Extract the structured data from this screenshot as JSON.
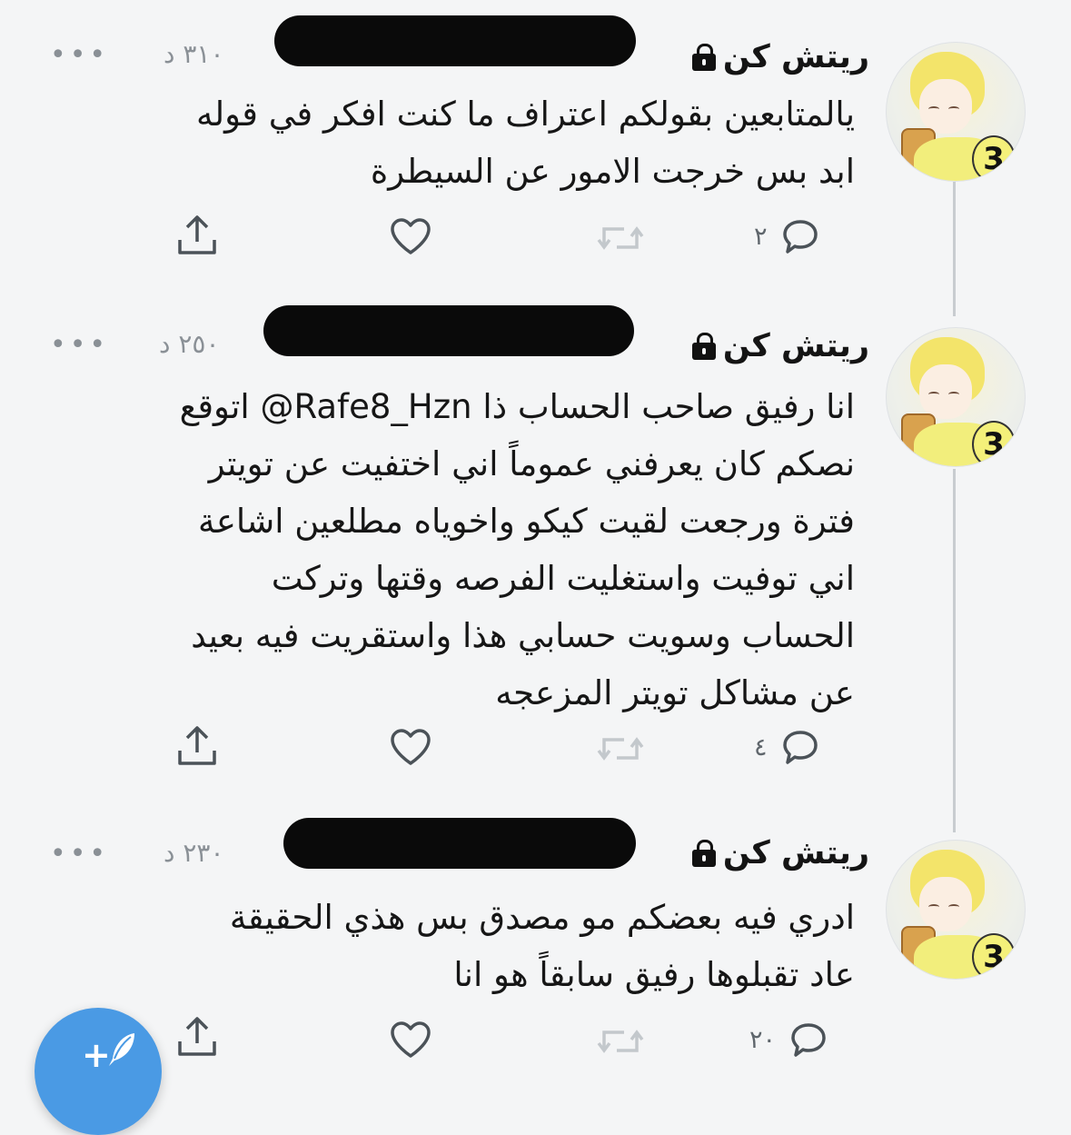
{
  "tweets": [
    {
      "display_name": "ريتش كن",
      "time": "٣١٠ د",
      "text": "يالمتابعين بقولكم اعتراف ما كنت افكر في قوله\nابد بس خرجت الامور عن السيطرة",
      "reply_count": "٢"
    },
    {
      "display_name": "ريتش كن",
      "time": "٢٥٠ د",
      "text": "انا رفيق صاحب الحساب ذا ‎@Rafe8_Hzn‏ اتوقع\nنصكم كان يعرفني عموماً اني اختفيت عن تويتر\nفترة ورجعت لقيت كيكو واخوياه مطلعين اشاعة\nاني توفيت واستغليت الفرصه وقتها وتركت\nالحساب وسويت حسابي هذا واستقريت فيه بعيد\nعن مشاكل تويتر المزعجه",
      "reply_count": "٤"
    },
    {
      "display_name": "ريتش كن",
      "time": "٢٣٠ د",
      "text": "ادري فيه بعضكم مو مصدق بس هذي الحقيقة\nعاد تقبلوها رفيق سابقاً هو انا",
      "reply_count": "٢٠"
    }
  ],
  "more_glyph": "•••",
  "avatar_badge": "3",
  "compose_plus": "+",
  "colors": {
    "background": "#f4f5f6",
    "text": "#161616",
    "muted": "#8a9096",
    "accent": "#4a9ae4",
    "redaction": "#0a0a0a"
  },
  "icons": [
    "lock-icon",
    "reply-icon",
    "retweet-icon",
    "like-icon",
    "share-icon",
    "more-icon",
    "compose-icon"
  ]
}
